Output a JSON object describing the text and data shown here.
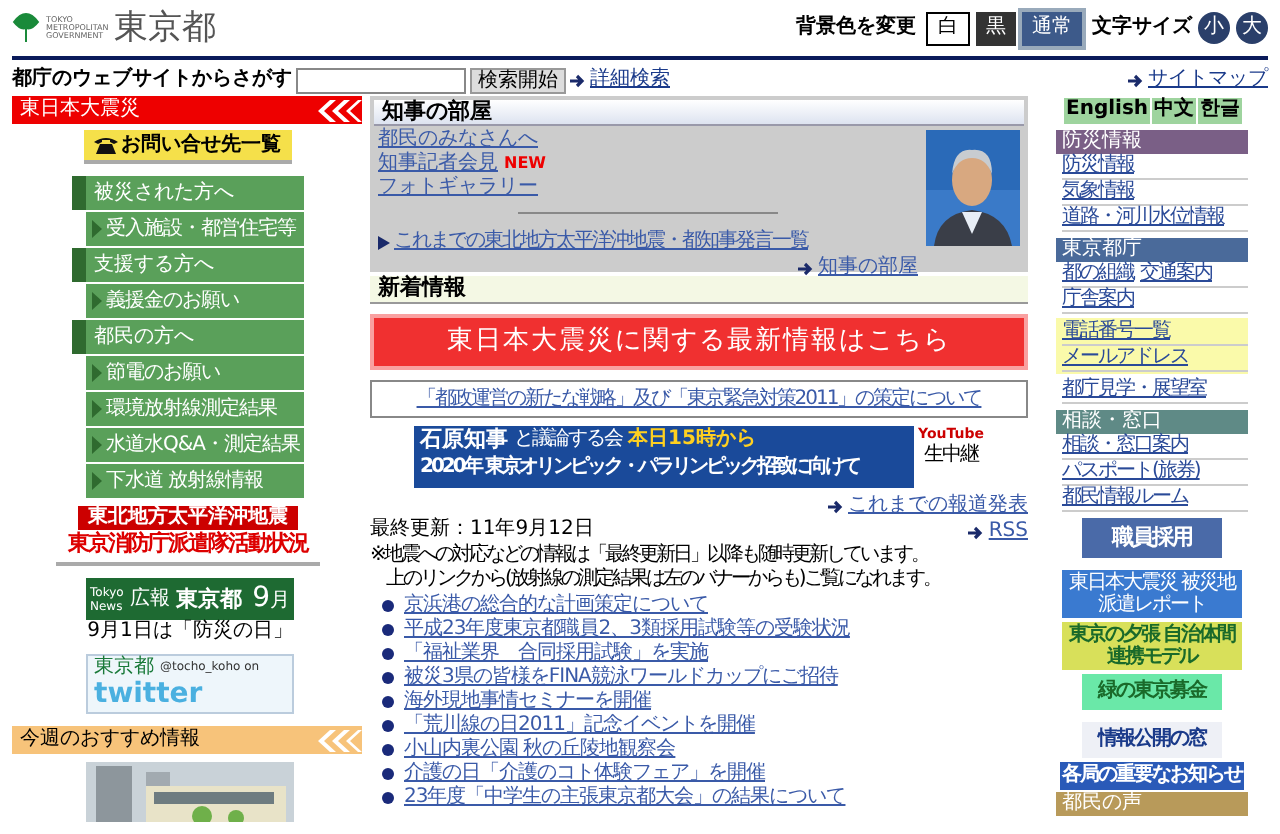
{
  "header": {
    "logo_lines": [
      "TOKYO",
      "METROPOLITAN",
      "GOVERNMENT"
    ],
    "logo_title": "東京都",
    "bg_label": "背景色を変更",
    "bg_buttons": [
      {
        "label": "白",
        "kind": "white",
        "selected": false
      },
      {
        "label": "黒",
        "kind": "black",
        "selected": false
      },
      {
        "label": "通常",
        "kind": "normal",
        "selected": true
      }
    ],
    "size_label": "文字サイズ",
    "size_buttons": [
      "小",
      "大"
    ]
  },
  "search": {
    "label": "都庁のウェブサイトからさがす",
    "button": "検索開始",
    "advanced": "詳細検索",
    "sitemap": "サイトマップ"
  },
  "left": {
    "disaster_header": "東日本大震災",
    "contact_button": "お問い合せ先一覧",
    "menu": [
      {
        "kind": "section",
        "label": "被災された方へ"
      },
      {
        "kind": "item",
        "label": "受入施設・都営住宅等"
      },
      {
        "kind": "section",
        "label": "支援する方へ"
      },
      {
        "kind": "item",
        "label": "義援金のお願い"
      },
      {
        "kind": "section",
        "label": "都民の方へ"
      },
      {
        "kind": "item",
        "label": "節電のお願い"
      },
      {
        "kind": "item",
        "label": "環境放射線測定結果"
      },
      {
        "kind": "item",
        "label": "水道水Q&A・測定結果"
      },
      {
        "kind": "item",
        "label": "下水道 放射線情報"
      }
    ],
    "fire_banner": {
      "top": "東北地方太平洋沖地震",
      "main": "東京消防庁派遣隊活動状況"
    },
    "news_banner": {
      "brand": [
        "Tokyo",
        "News"
      ],
      "tag": "広報",
      "title": "東京都",
      "month": "9",
      "month_unit": "月"
    },
    "news_caption": "9月1日は「防災の日」",
    "twitter": {
      "brand": "東京都",
      "handle": "@tocho_koho on",
      "word": "twitter"
    },
    "recommend_header": "今週のおすすめ情報"
  },
  "center": {
    "governor": {
      "title": "知事の部屋",
      "links": [
        {
          "label": "都民のみなさんへ",
          "new": false
        },
        {
          "label": "知事記者会見",
          "new": true
        },
        {
          "label": "フォトギャラリー",
          "new": false
        }
      ],
      "new_label": "NEW",
      "statements_link": "これまでの東北地方太平洋沖地震・都知事発言一覧",
      "more_link": "知事の部屋"
    },
    "news_title": "新着情報",
    "big_banner": "東日本大震災に関する最新情報はこちら",
    "strategy_link": "「都政運営の新たな戦略」及び「東京緊急対策2011」の策定について",
    "olympic": {
      "name": "石原知事",
      "small": "と議論する会",
      "time": "本日15時から",
      "line2": "2020年 東京オリンピック・パラリンピック招致に向けて",
      "yt": "YouTube",
      "live": "生中継"
    },
    "press_link": "これまでの報道発表",
    "updated": "最終更新：11年9月12日",
    "rss": "RSS",
    "notice": [
      "※地震への対応などの情報は「最終更新日」以降も随時更新しています。",
      "上のリンクから(放射線の測定結果は左のバナーからも)ご覧になれます。"
    ],
    "items": [
      "京浜港の総合的な計画策定について",
      "平成23年度東京都職員2、3類採用試験等の受験状況",
      "「福祉業界　合同採用試験」を実施",
      "被災3県の皆様をFINA競泳ワールドカップにご招待",
      "海外現地事情セミナーを開催",
      "「荒川線の日2011」記念イベントを開催",
      "小山内裏公園 秋の丘陵地観察会",
      "介護の日「介護のコト体験フェア」を開催",
      "23年度「中学生の主張東京都大会」の結果について"
    ]
  },
  "right": {
    "languages": [
      "English",
      "中文",
      "한글"
    ],
    "sections": [
      {
        "title": "防災情報",
        "color": "#7a5f86",
        "groups": [
          {
            "highlight": false,
            "rows": [
              [
                "防災情報"
              ],
              [
                "気象情報"
              ],
              [
                "道路・河川水位情報"
              ]
            ]
          }
        ]
      },
      {
        "title": "東京都庁",
        "color": "#4a6a9a",
        "groups": [
          {
            "highlight": false,
            "rows": [
              [
                "都の組織",
                "交通案内"
              ],
              [
                "庁舎案内"
              ]
            ]
          },
          {
            "highlight": true,
            "rows": [
              [
                "電話番号一覧"
              ],
              [
                "メールアドレス"
              ]
            ]
          },
          {
            "highlight": false,
            "rows": [
              [
                "都庁見学・展望室"
              ]
            ]
          }
        ]
      },
      {
        "title": "相談・窓口",
        "color": "#5f8a86",
        "groups": [
          {
            "highlight": false,
            "rows": [
              [
                "相談・窓口案内"
              ],
              [
                "パスポート(旅券)"
              ],
              [
                "都民情報ルーム"
              ]
            ]
          }
        ]
      }
    ],
    "banners": [
      "職員採用",
      "東日本大震災 被災地派遣レポート",
      "東京の夕張 自治体間連携モデル",
      "緑の東京募金",
      "情報公開の窓",
      "各局の重要なお知らせ"
    ],
    "voice_header": "都民の声"
  }
}
